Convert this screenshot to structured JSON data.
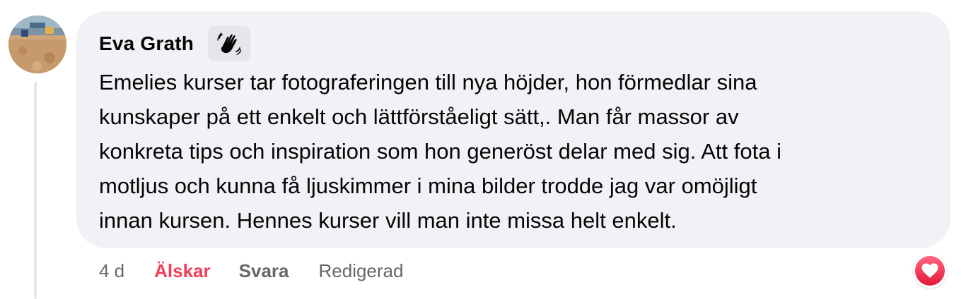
{
  "comment": {
    "author": "Eva Grath",
    "badge_icon": "waving-hand-icon",
    "text": "Emelies kurser tar fotograferingen till nya höjder, hon förmedlar sina\nkunskaper på ett enkelt och lättförståeligt sätt,. Man får massor av\nkonkreta tips och inspiration som hon generöst delar med sig. Att fota i\nmotljus och kunna få ljuskimmer i mina bilder trodde jag var omöjligt\ninnan kursen. Hennes kurser vill man inte missa helt enkelt."
  },
  "actions": {
    "time": "4 d",
    "love_label": "Älskar",
    "reply_label": "Svara",
    "edited_label": "Redigerad"
  },
  "reaction": {
    "icon": "heart-icon",
    "color": "#f33e58"
  },
  "colors": {
    "bubble_bg": "#f0f2f5",
    "love_accent": "#f33e58",
    "secondary_text": "#65676b"
  }
}
